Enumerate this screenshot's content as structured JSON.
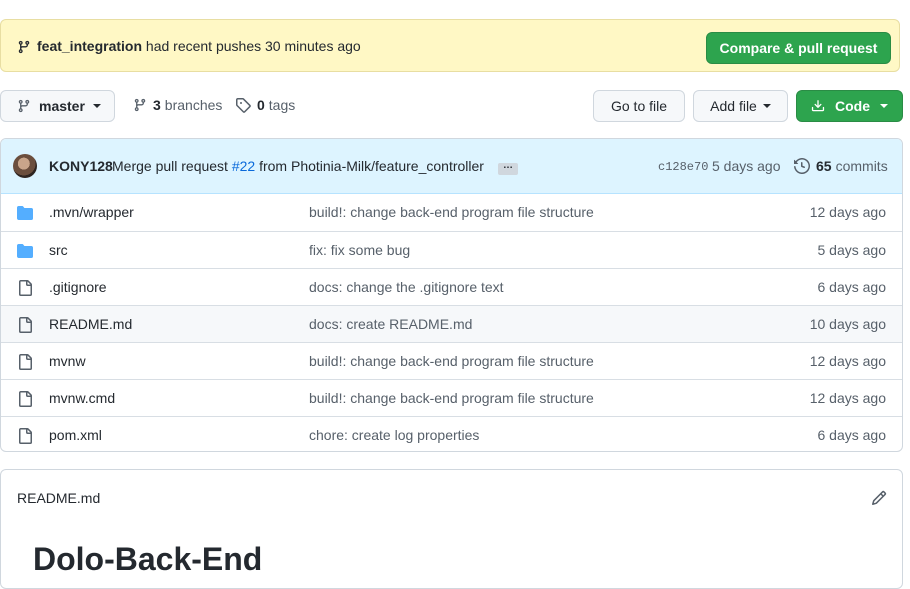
{
  "banner": {
    "branch_name": "feat_integration",
    "text": "had recent pushes 30 minutes ago",
    "compare_button": "Compare & pull request"
  },
  "toolbar": {
    "branch_label": "master",
    "branches_count": "3",
    "branches_label": "branches",
    "tags_count": "0",
    "tags_label": "tags",
    "go_to_file": "Go to file",
    "add_file": "Add file",
    "code": "Code"
  },
  "latest_commit": {
    "author": "KONY128",
    "message_prefix": "Merge pull request",
    "pr_number": "#22",
    "message_suffix": "from Photinia-Milk/feature_controller",
    "ellipsis": "…",
    "sha": "c128e70",
    "time": "5 days ago",
    "commits_count": "65",
    "commits_label": "commits"
  },
  "files": [
    {
      "type": "folder",
      "name": ".mvn/wrapper",
      "message": "build!: change back-end program file structure",
      "age": "12 days ago"
    },
    {
      "type": "folder",
      "name": "src",
      "message": "fix: fix some bug",
      "age": "5 days ago"
    },
    {
      "type": "file",
      "name": ".gitignore",
      "message": "docs: change the .gitignore text",
      "age": "6 days ago"
    },
    {
      "type": "file",
      "name": "README.md",
      "message": "docs: create README.md",
      "age": "10 days ago"
    },
    {
      "type": "file",
      "name": "mvnw",
      "message": "build!: change back-end program file structure",
      "age": "12 days ago"
    },
    {
      "type": "file",
      "name": "mvnw.cmd",
      "message": "build!: change back-end program file structure",
      "age": "12 days ago"
    },
    {
      "type": "file",
      "name": "pom.xml",
      "message": "chore: create log properties",
      "age": "6 days ago"
    }
  ],
  "readme": {
    "title": "README.md",
    "heading": "Dolo-Back-End"
  },
  "colors": {
    "accent_green": "#2da44e",
    "link_blue": "#0969da",
    "banner_bg": "#fff8c5",
    "commit_bar_bg": "#ddf4ff",
    "folder_blue": "#54aeff"
  }
}
